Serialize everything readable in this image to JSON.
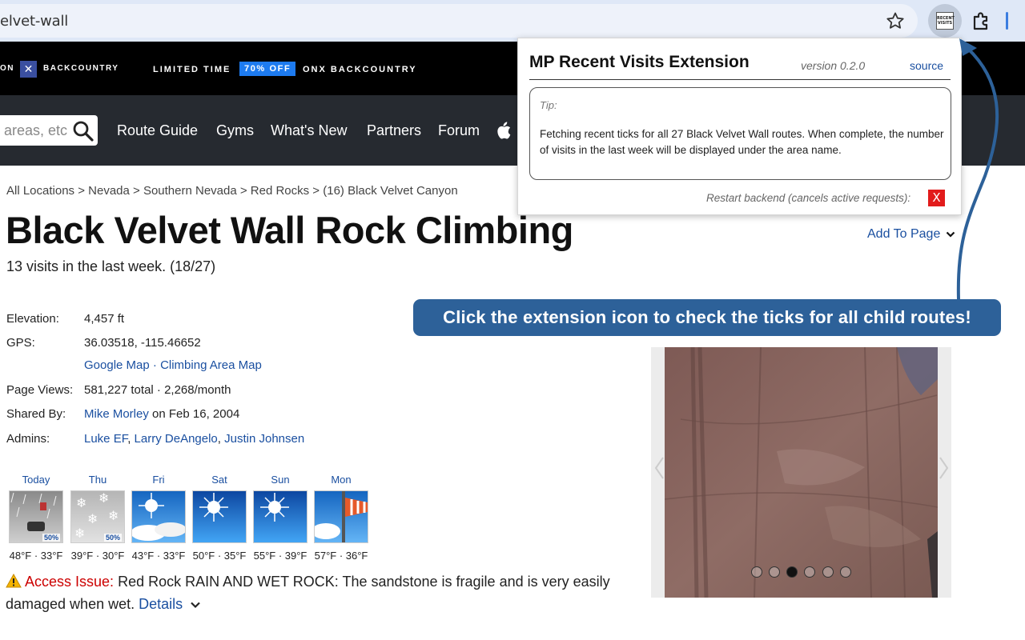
{
  "browser": {
    "url": "elvet-wall"
  },
  "promo": {
    "brand_left": "ON",
    "brand_right": "BACKCOUNTRY",
    "limited_time": "LIMITED TIME",
    "discount": "70% OFF",
    "product": "ONX BACKCOUNTRY"
  },
  "nav": {
    "search_placeholder": "areas, etc",
    "links": [
      "Route Guide",
      "Gyms",
      "What's New",
      "Partners",
      "Forum"
    ]
  },
  "page": {
    "breadcrumb": "All Locations > Nevada > Southern Nevada > Red Rocks > (16) Black Velvet Canyon",
    "title": "Black Velvet Wall Rock Climbing",
    "visits": "13 visits in the last week. (18/27)",
    "add_to_page": "Add To Page"
  },
  "info": {
    "elevation_label": "Elevation:",
    "elevation": "4,457 ft",
    "gps_label": "GPS:",
    "gps": "36.03518, -115.46652",
    "google_map": "Google Map",
    "separator": " · ",
    "area_map": "Climbing Area Map",
    "views_label": "Page Views:",
    "views": "581,227 total · 2,268/month",
    "shared_label": "Shared By:",
    "shared_by": "Mike Morley",
    "shared_date": " on Feb 16, 2004",
    "admins_label": "Admins:",
    "admin1": "Luke EF",
    "admin2": "Larry DeAngelo",
    "admin3": "Justin Johnsen",
    "comma": ", "
  },
  "weather": [
    {
      "day": "Today",
      "temp": "48°F · 33°F",
      "pct": "50%",
      "kind": "rain"
    },
    {
      "day": "Thu",
      "temp": "39°F · 30°F",
      "pct": "50%",
      "kind": "snow"
    },
    {
      "day": "Fri",
      "temp": "43°F · 33°F",
      "pct": "",
      "kind": "partly"
    },
    {
      "day": "Sat",
      "temp": "50°F · 35°F",
      "pct": "",
      "kind": "sunny"
    },
    {
      "day": "Sun",
      "temp": "55°F · 39°F",
      "pct": "",
      "kind": "sunny"
    },
    {
      "day": "Mon",
      "temp": "57°F · 36°F",
      "pct": "",
      "kind": "windy"
    }
  ],
  "access": {
    "label": "Access Issue:",
    "text": " Red Rock RAIN AND WET ROCK: The sandstone is fragile and is very easily damaged when wet. ",
    "details": "Details"
  },
  "popup": {
    "title": "MP Recent Visits Extension",
    "version": "version 0.2.0",
    "source": "source",
    "tip_label": "Tip:",
    "tip_text": "Fetching recent ticks for all 27 Black Velvet Wall routes. When complete, the number of visits in the last week will be displayed under the area name.",
    "restart_text": "Restart backend (cancels active requests):",
    "restart_btn": "X"
  },
  "callout": {
    "text": "Click the extension icon to check the ticks for all child routes!"
  },
  "extension_icon": {
    "line1": "RECENT",
    "line2": "VISITS"
  },
  "photo": {
    "active_dot": 2,
    "dot_count": 6
  },
  "colors": {
    "nav_bg": "#262a30",
    "link": "#1a4fa0",
    "callout": "#2d6199",
    "discount": "#1d7bf0",
    "warning": "#cc0000"
  }
}
